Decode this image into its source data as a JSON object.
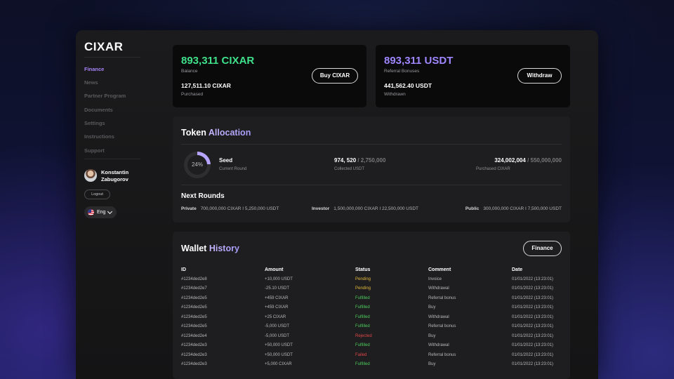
{
  "brand": {
    "logo": "CIXAR"
  },
  "sidebar": {
    "items": [
      {
        "label": "Finance",
        "active": true
      },
      {
        "label": "News",
        "active": false
      },
      {
        "label": "Partner Program",
        "active": false
      },
      {
        "label": "Documents",
        "active": false
      },
      {
        "label": "Settings",
        "active": false
      },
      {
        "label": "Instructions",
        "active": false
      },
      {
        "label": "Support",
        "active": false
      }
    ],
    "user": {
      "name": "Konstantin Zabugorov"
    },
    "logout_label": "Logout",
    "language": "Eng"
  },
  "balance_card": {
    "amount": "893,311 CIXAR",
    "amount_color": "#3fe08a",
    "label": "Balance",
    "purchased_amount": "127,511.10 CIXAR",
    "purchased_label": "Purchased",
    "button_label": "Buy CIXAR"
  },
  "referral_card": {
    "amount": "893,311 USDT",
    "amount_color": "#9f86ff",
    "label": "Referral Bonuses",
    "withdrawn_amount": "441,562.40 USDT",
    "withdrawn_label": "Withdrawn",
    "button_label": "Withdraw"
  },
  "token_allocation": {
    "title_prefix": "Token ",
    "title_accent": "Allocation",
    "round_progress": 24,
    "round_progress_label": "24%",
    "current_round_name": "Seed",
    "current_round_label": "Current Round",
    "collected_value": "974, 520",
    "collected_total": " / 2,750,000",
    "collected_label": "Collected USDT",
    "purchased_value": "324,002,004",
    "purchased_total": " / 550,000,000",
    "purchased_label": "Purchased CIXAR",
    "next_rounds_title": "Next Rounds",
    "next_rounds": [
      {
        "name": "Private",
        "detail": "700,000,000 CIXAR I 5,250,000 USDT"
      },
      {
        "name": "Investor",
        "detail": "1,500,000,000 CIXAR I 22,500,000 USDT"
      },
      {
        "name": "Public",
        "detail": "300,000,000 CIXAR I 7,500,000 USDT"
      }
    ]
  },
  "wallet_history": {
    "title_prefix": "Wallet ",
    "title_accent": "History",
    "filter_button": "Finance",
    "columns": [
      "ID",
      "Amount",
      "Status",
      "Comment",
      "Date"
    ],
    "rows": [
      {
        "id": "#1234ded2e8",
        "amount": "+10,000 USDT",
        "status": "Pending",
        "comment": "Invoice",
        "date": "01/01/2022 (13:23:01)"
      },
      {
        "id": "#1234ded2e7",
        "amount": "-25.10 USDT",
        "status": "Pending",
        "comment": "Withdrawal",
        "date": "01/01/2022 (13:23:01)"
      },
      {
        "id": "#1234ded2e5",
        "amount": "+459 CIXAR",
        "status": "Fulfilled",
        "comment": "Referral bonus",
        "date": "01/01/2022 (13:23:01)"
      },
      {
        "id": "#1234ded2e5",
        "amount": "+459 CIXAR",
        "status": "Fulfilled",
        "comment": "Buy",
        "date": "01/01/2022 (13:23:01)"
      },
      {
        "id": "#1234ded2e5",
        "amount": "+25 CIXAR",
        "status": "Fulfilled",
        "comment": "Withdrawal",
        "date": "01/01/2022 (13:23:01)"
      },
      {
        "id": "#1234ded2e5",
        "amount": "-5,000 USDT",
        "status": "Fulfilled",
        "comment": "Referral bonus",
        "date": "01/01/2022 (13:23:01)"
      },
      {
        "id": "#1234ded2e4",
        "amount": "-5,000 USDT",
        "status": "Rejected",
        "comment": "Buy",
        "date": "01/01/2022 (13:23:01)"
      },
      {
        "id": "#1234ded2e3",
        "amount": "+50,000 USDT",
        "status": "Fulfilled",
        "comment": "Withdrawal",
        "date": "01/01/2022 (13:23:01)"
      },
      {
        "id": "#1234ded2e3",
        "amount": "+50,000 USDT",
        "status": "Failed",
        "comment": "Referral bonus",
        "date": "01/01/2022 (13:23:01)"
      },
      {
        "id": "#1234ded2e3",
        "amount": "+5,000 CIXAR",
        "status": "Fulfilled",
        "comment": "Buy",
        "date": "01/01/2022 (13:23:01)"
      }
    ]
  }
}
